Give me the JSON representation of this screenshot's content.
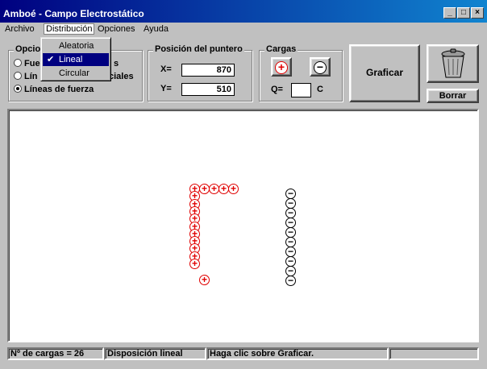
{
  "window": {
    "title": "Amboé  - Campo Electrostático",
    "controls": {
      "minimize": "_",
      "maximize": "□",
      "close": "×"
    }
  },
  "menu": {
    "items": [
      "Archivo",
      "Distribución",
      "Opciones",
      "Ayuda"
    ]
  },
  "dropdown": {
    "items": [
      "Aleatoria",
      "Lineal",
      "Circular"
    ],
    "selected_check": "✔"
  },
  "options": {
    "label": "Opcio",
    "radios": [
      {
        "label": "Fue",
        "label_tail": "s"
      },
      {
        "label": "Lín",
        "label_tail": "ciales"
      },
      {
        "label": "Líneas de fuerza"
      }
    ]
  },
  "pointer": {
    "label": "Posición del puntero",
    "x_label": "X=",
    "x_value": "870",
    "y_label": "Y=",
    "y_value": "510"
  },
  "charges": {
    "label": "Cargas",
    "plus_symbol": "+",
    "minus_symbol": "−",
    "q_label": "Q=",
    "q_value": "",
    "unit": "C"
  },
  "buttons": {
    "plot": "Graficar",
    "clear": "Borrar"
  },
  "status": {
    "count": "Nº  de cargas = 26",
    "layout": "Disposición lineal",
    "hint": "Haga clic sobre Graficar.",
    "extra": ""
  },
  "colors": {
    "positive": "#e00000",
    "negative": "#000000",
    "title_bar": "#000080",
    "menu_highlight": "#000080"
  },
  "scene": {
    "positive_symbol": "+",
    "negative_symbol": "−",
    "positive_count": 16,
    "negative_count": 10
  }
}
